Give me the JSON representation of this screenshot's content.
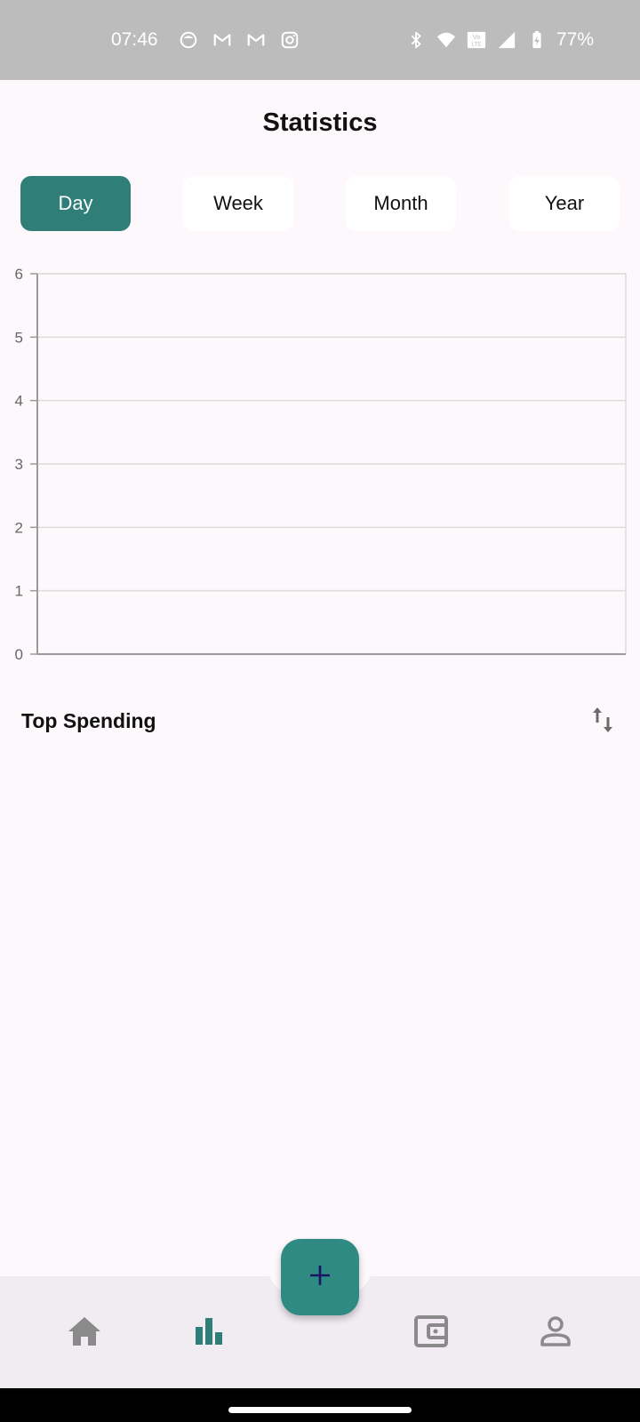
{
  "status_bar": {
    "time": "07:46",
    "left_icons": [
      "user-icon",
      "gmail-icon",
      "gmail-icon",
      "instagram-icon"
    ],
    "right_icons": [
      "bluetooth-icon",
      "wifi-icon",
      "volte-icon",
      "signal-icon",
      "battery-icon"
    ],
    "volte_label": "Vo LTE",
    "battery": "77%"
  },
  "header": {
    "title": "Statistics"
  },
  "period_tabs": [
    {
      "label": "Day",
      "active": true
    },
    {
      "label": "Week",
      "active": false
    },
    {
      "label": "Month",
      "active": false
    },
    {
      "label": "Year",
      "active": false
    }
  ],
  "chart_data": {
    "type": "line",
    "x": [],
    "series": [],
    "ylim": [
      0,
      6
    ],
    "yticks": [
      "0",
      "1",
      "2",
      "3",
      "4",
      "5",
      "6"
    ],
    "grid": true,
    "title": "",
    "xlabel": "",
    "ylabel": ""
  },
  "top_spending": {
    "title": "Top Spending",
    "sort_icon": "swap-vert-icon"
  },
  "bottom_nav": {
    "items": [
      {
        "icon": "home-icon",
        "active": false
      },
      {
        "icon": "bar-chart-icon",
        "active": true
      },
      {
        "icon": "wallet-icon",
        "active": false
      },
      {
        "icon": "profile-icon",
        "active": false
      }
    ],
    "fab_icon": "plus-icon"
  },
  "colors": {
    "accent": "#2f7f78",
    "fab": "#2f8a84",
    "fab_icon": "#1b1464",
    "nav_inactive": "#8a8a8a",
    "background": "#fdf8fc",
    "nav_background": "#f0ecf2"
  }
}
